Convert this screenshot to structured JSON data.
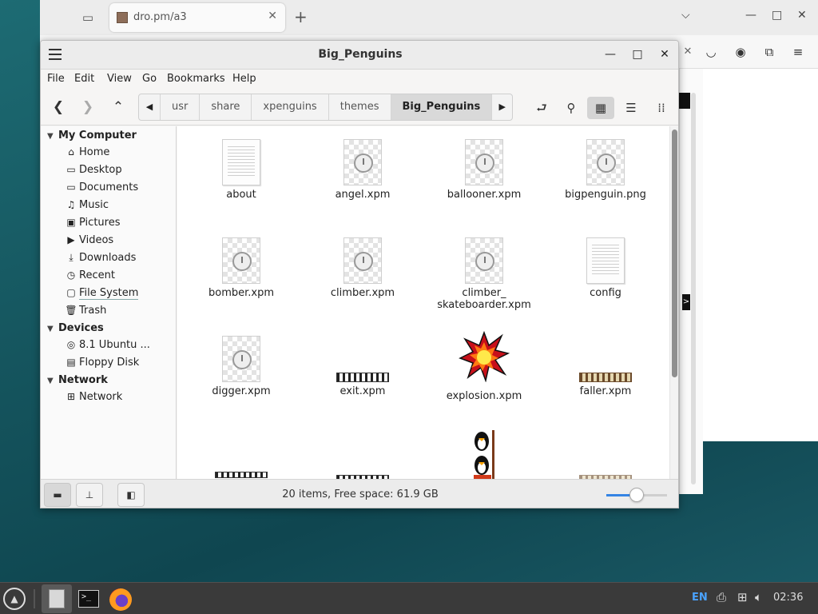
{
  "browser": {
    "tab_title": "dro.pm/a3",
    "tab_close": "✕",
    "new_tab": "+"
  },
  "window": {
    "title": "Big_Penguins",
    "minimize": "—",
    "maximize": "□",
    "close": "✕"
  },
  "menu": [
    "File",
    "Edit",
    "View",
    "Go",
    "Bookmarks",
    "Help"
  ],
  "pathbar": [
    "usr",
    "share",
    "xpenguins",
    "themes",
    "Big_Penguins"
  ],
  "sidebar": {
    "my_computer": "My Computer",
    "places": [
      {
        "label": "Home",
        "icon": "home-icon"
      },
      {
        "label": "Desktop",
        "icon": "folder-icon"
      },
      {
        "label": "Documents",
        "icon": "folder-icon"
      },
      {
        "label": "Music",
        "icon": "music-icon"
      },
      {
        "label": "Pictures",
        "icon": "pictures-icon"
      },
      {
        "label": "Videos",
        "icon": "videos-icon"
      },
      {
        "label": "Downloads",
        "icon": "download-icon"
      },
      {
        "label": "Recent",
        "icon": "recent-icon"
      },
      {
        "label": "File System",
        "icon": "drive-icon"
      },
      {
        "label": "Trash",
        "icon": "trash-icon"
      }
    ],
    "devices": "Devices",
    "device_items": [
      {
        "label": "8.1 Ubuntu ...",
        "icon": "disc-icon"
      },
      {
        "label": "Floppy Disk",
        "icon": "floppy-icon"
      }
    ],
    "network": "Network",
    "network_items": [
      {
        "label": "Network",
        "icon": "network-icon"
      }
    ]
  },
  "files": [
    {
      "name": "about",
      "type": "doc"
    },
    {
      "name": "angel.xpm",
      "type": "img"
    },
    {
      "name": "ballooner.xpm",
      "type": "img"
    },
    {
      "name": "bigpenguin.png",
      "type": "img"
    },
    {
      "name": "bomber.xpm",
      "type": "img"
    },
    {
      "name": "climber.xpm",
      "type": "img"
    },
    {
      "name": "climber_\nskateboarder.xpm",
      "type": "img"
    },
    {
      "name": "config",
      "type": "doc"
    },
    {
      "name": "digger.xpm",
      "type": "img"
    },
    {
      "name": "exit.xpm",
      "type": "strip"
    },
    {
      "name": "explosion.xpm",
      "type": "explosion"
    },
    {
      "name": "faller.xpm",
      "type": "strip-brown"
    }
  ],
  "status": {
    "text": "20 items, Free space: 61.9 GB",
    "zoom_level": 0.5
  },
  "taskbar": {
    "lang": "EN",
    "time": "02:36"
  }
}
